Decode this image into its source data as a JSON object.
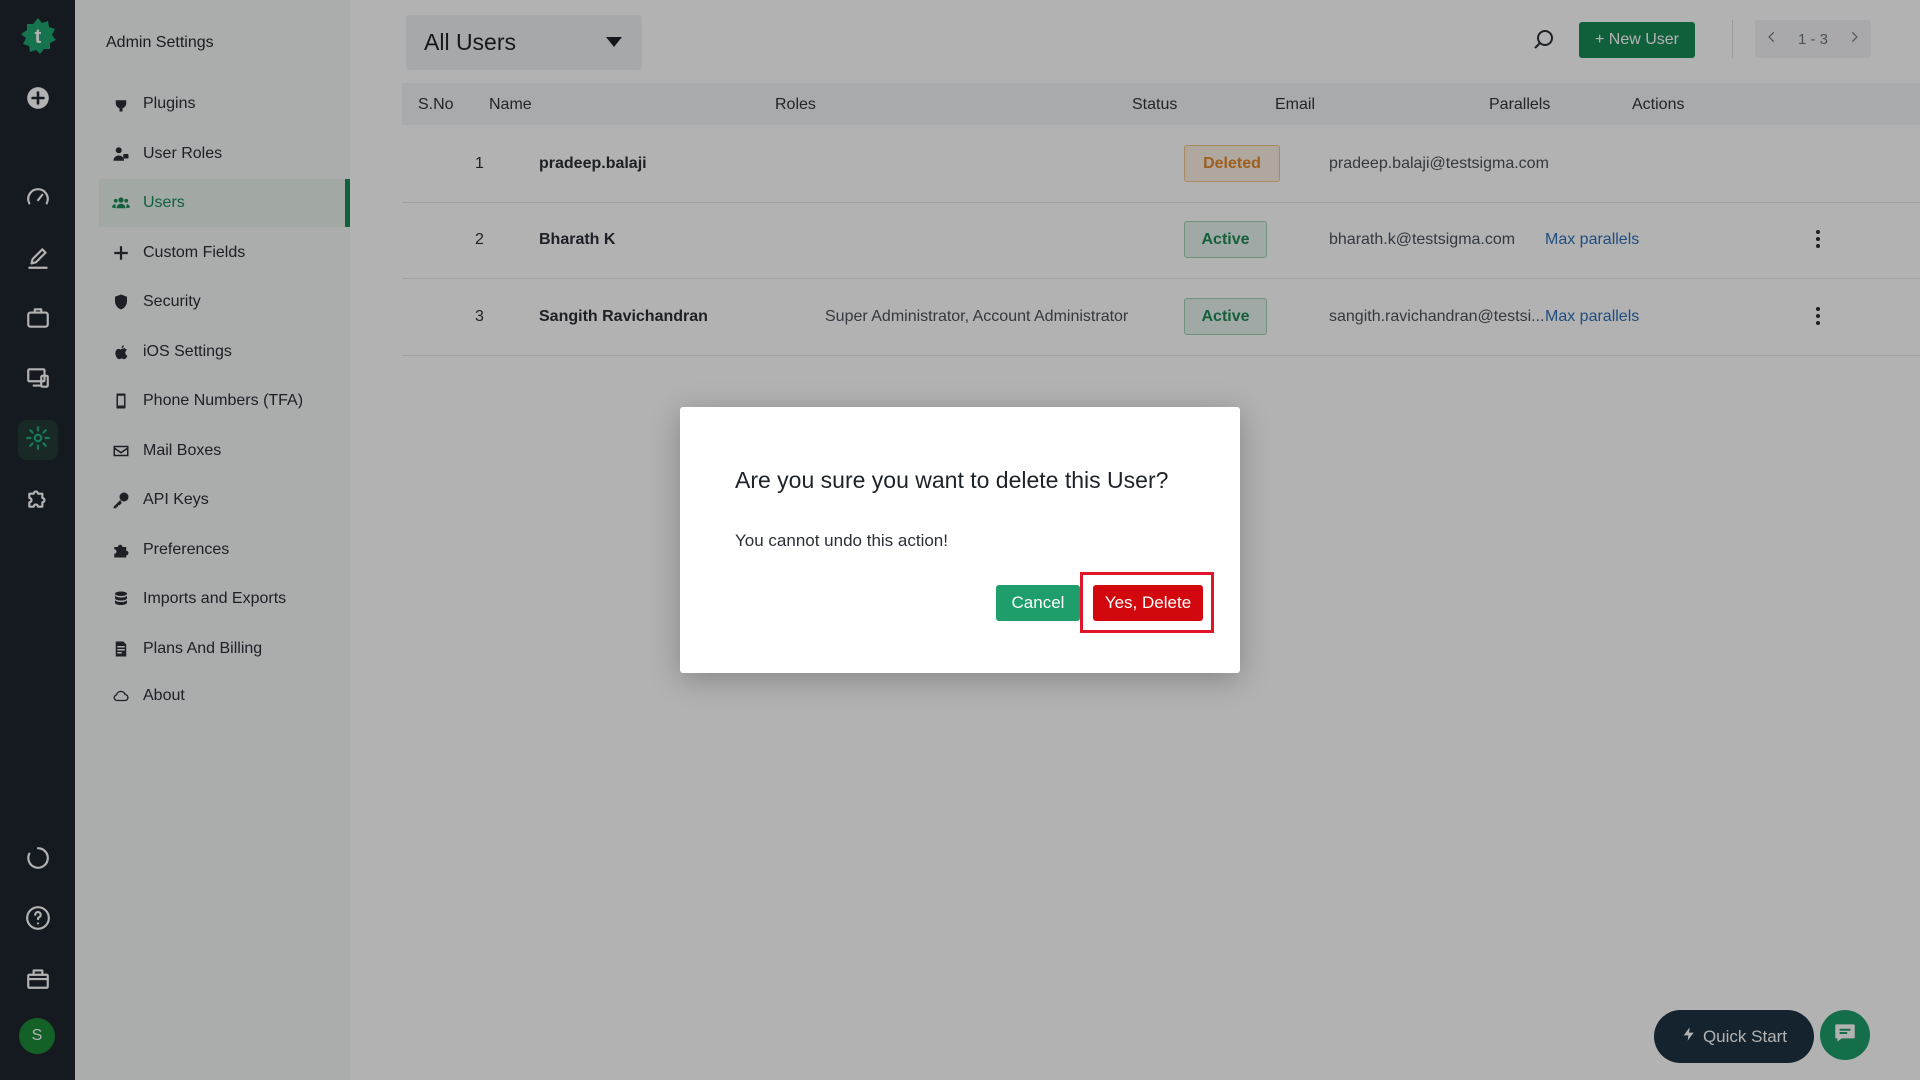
{
  "rail": {
    "logo_letter": "t",
    "avatar_initial": "S",
    "items": [
      {
        "icon": "plus-circle-icon"
      },
      {
        "icon": "dashboard-icon"
      },
      {
        "icon": "edit-icon"
      },
      {
        "icon": "briefcase-icon"
      },
      {
        "icon": "monitor-devices-icon"
      },
      {
        "icon": "gear-icon"
      },
      {
        "icon": "puzzle-icon"
      },
      {
        "icon": "refresh-icon"
      },
      {
        "icon": "help-icon"
      },
      {
        "icon": "gift-icon"
      }
    ]
  },
  "sidebar": {
    "title": "Admin Settings",
    "items": [
      {
        "label": "Plugins",
        "icon": "plug-icon"
      },
      {
        "label": "User Roles",
        "icon": "user-roles-icon"
      },
      {
        "label": "Users",
        "icon": "users-icon",
        "active": true
      },
      {
        "label": "Custom Fields",
        "icon": "plus-icon"
      },
      {
        "label": "Security",
        "icon": "shield-icon"
      },
      {
        "label": "iOS Settings",
        "icon": "apple-icon"
      },
      {
        "label": "Phone Numbers (TFA)",
        "icon": "phone-icon"
      },
      {
        "label": "Mail Boxes",
        "icon": "mail-icon"
      },
      {
        "label": "API Keys",
        "icon": "key-icon"
      },
      {
        "label": "Preferences",
        "icon": "puzzle-piece-icon"
      },
      {
        "label": "Imports and Exports",
        "icon": "database-icon"
      },
      {
        "label": "Plans And Billing",
        "icon": "billing-icon"
      },
      {
        "label": "About",
        "icon": "cloud-icon"
      }
    ]
  },
  "toolbar": {
    "filter_value": "All Users",
    "new_user_label": "+ New User",
    "pagination": "1 - 3"
  },
  "table": {
    "headers": {
      "sno": "S.No",
      "name": "Name",
      "roles": "Roles",
      "status": "Status",
      "email": "Email",
      "parallels": "Parallels",
      "actions": "Actions"
    },
    "rows": [
      {
        "sno": "1",
        "name": "pradeep.balaji",
        "roles": "",
        "status": "Deleted",
        "email": "pradeep.balaji@testsigma.com",
        "parallels": ""
      },
      {
        "sno": "2",
        "name": "Bharath K",
        "roles": "",
        "status": "Active",
        "email": "bharath.k@testsigma.com",
        "parallels": "Max parallels"
      },
      {
        "sno": "3",
        "name": "Sangith Ravichandran",
        "roles": "Super Administrator, Account Administrator",
        "status": "Active",
        "email": "sangith.ravichandran@testsi...",
        "parallels": "Max parallels"
      }
    ]
  },
  "modal": {
    "title": "Are you sure you want to delete this User?",
    "message": "You cannot undo this action!",
    "cancel_label": "Cancel",
    "confirm_label": "Yes, Delete"
  },
  "floating": {
    "quick_start_label": "Quick Start"
  },
  "colors": {
    "rail_bg": "#1e262d",
    "primary_green": "#198a57",
    "delete_red": "#d3080f",
    "highlight_red": "#e0152a"
  }
}
